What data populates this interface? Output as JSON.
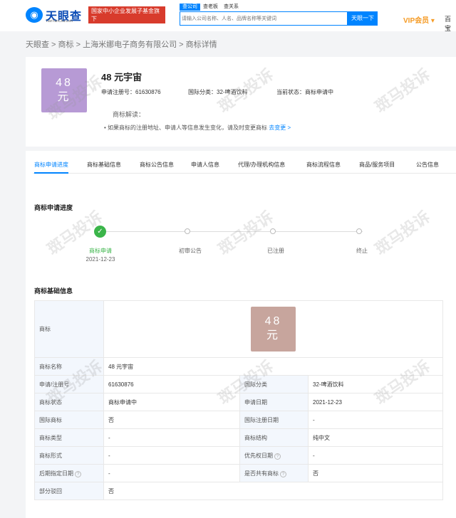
{
  "topbar": {
    "logo_cn": "天眼查",
    "logo_en": "TianYanCha.com",
    "promo_line1": "国家中小企业发展子基金旗下",
    "promo_line2": "官方备案企业征信机构",
    "search_tabs": [
      "查公司",
      "查老板",
      "查关系"
    ],
    "search_placeholder": "请输入公司名称、人名、品牌名称等关键词",
    "search_button": "天眼一下",
    "vip": "VIP会员",
    "extra": "百宝"
  },
  "breadcrumb": "天眼查 > 商标 > 上海米娜电子商务有限公司 > 商标详情",
  "header": {
    "logo_text_line1": "48",
    "logo_text_line2": "元",
    "name": "48 元宇宙",
    "reg_no_label": "申请注册号：61630876",
    "class_label": "国际分类：32-啤酒饮料",
    "status_label": "当前状态：商标申请中",
    "interp_label": "商标解读：",
    "interp_text": "• 如果商标的注册地址、申请人等信息发生变化，请及时变更商标",
    "interp_link": "去变更 >"
  },
  "tabs": [
    "商标申请进度",
    "商标基础信息",
    "商标公告信息",
    "申请人信息",
    "代理/办理机构信息",
    "商标流程信息",
    "商品/服务项目",
    "公告信息"
  ],
  "progress": {
    "title": "商标申请进度",
    "steps": [
      "商标申请",
      "初审公告",
      "已注册",
      "终止"
    ],
    "date": "2021-12-23"
  },
  "basic": {
    "title": "商标基础信息",
    "logo_label": "商标",
    "rows": [
      {
        "k1": "商标名称",
        "v1": "48 元宇宙"
      },
      {
        "k1": "申请/注册号",
        "v1": "61630876",
        "k2": "国际分类",
        "v2": "32-啤酒饮料"
      },
      {
        "k1": "商标状态",
        "v1": "商标申请中",
        "k2": "申请日期",
        "v2": "2021-12-23"
      },
      {
        "k1": "国际商标",
        "v1": "否",
        "k2": "国际注册日期",
        "v2": "-"
      },
      {
        "k1": "商标类型",
        "v1": "-",
        "k2": "商标结构",
        "v2": "纯中文"
      },
      {
        "k1": "商标形式",
        "v1": "-",
        "k2": "优先权日期",
        "v2": "-"
      },
      {
        "k1": "后期指定日期",
        "v1": "-",
        "k2": "是否共有商标",
        "v2": "否"
      },
      {
        "k1": "部分驳回",
        "v1": "否"
      }
    ]
  },
  "watermark": "斑马投诉",
  "colors": {
    "accent": "#0084ff",
    "success": "#3bb54a",
    "promo": "#d83b2c",
    "vip": "#f59a23"
  }
}
